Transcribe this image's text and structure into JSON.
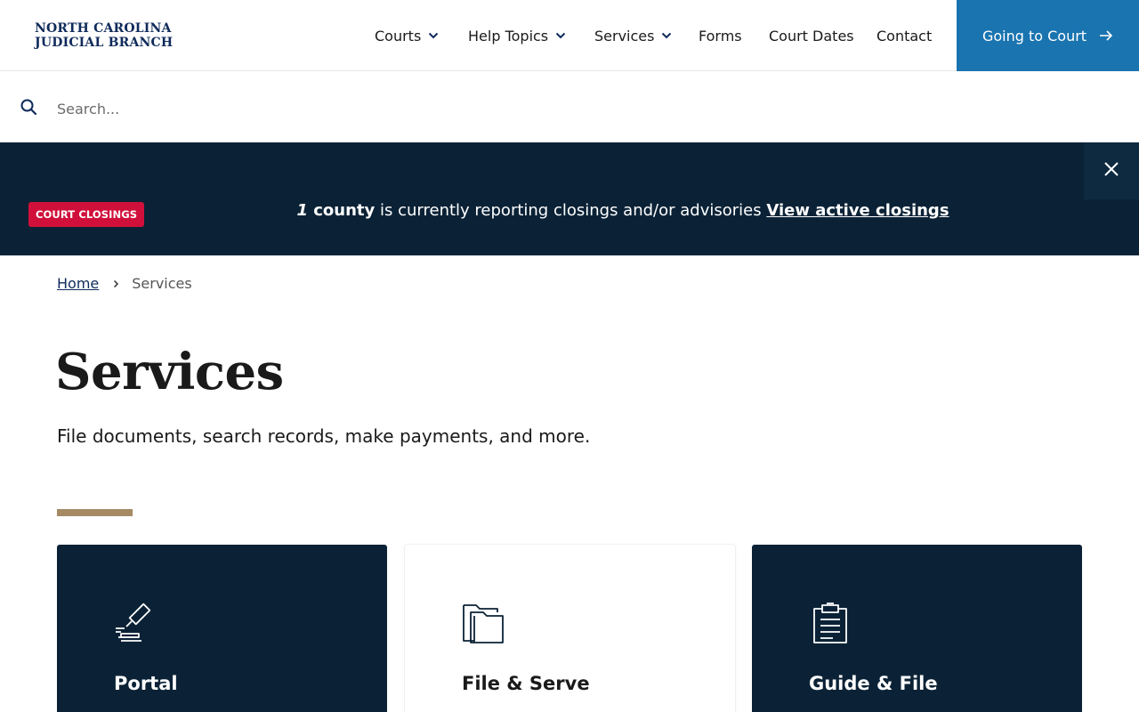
{
  "header": {
    "logo_line1": "NORTH CAROLINA",
    "logo_line2": "JUDICIAL BRANCH",
    "nav": [
      {
        "label": "Courts"
      },
      {
        "label": "Help Topics"
      },
      {
        "label": "Services"
      },
      {
        "label": "Forms"
      },
      {
        "label": "Court Dates"
      },
      {
        "label": "Contact"
      }
    ],
    "cta_label": "Going to Court"
  },
  "search": {
    "placeholder": "Search..."
  },
  "alert": {
    "badge": "COURT CLOSINGS",
    "count_number": "1",
    "count_unit": "county",
    "message": "is currently reporting closings and/or advisories",
    "link": "View active closings"
  },
  "breadcrumb": {
    "home": "Home",
    "current": "Services"
  },
  "page": {
    "title": "Services",
    "lead": "File documents, search records, make payments, and more."
  },
  "cards": [
    {
      "title": "Portal",
      "icon": "gavel-icon"
    },
    {
      "title": "File & Serve",
      "icon": "folder-icon"
    },
    {
      "title": "Guide & File",
      "icon": "clipboard-icon"
    }
  ],
  "colors": {
    "navy": "#0b2236",
    "cta_blue": "#1a74b0",
    "alert_red": "#d0103a",
    "accent_gold": "#a58a64",
    "logo_blue": "#0f2b5b"
  }
}
